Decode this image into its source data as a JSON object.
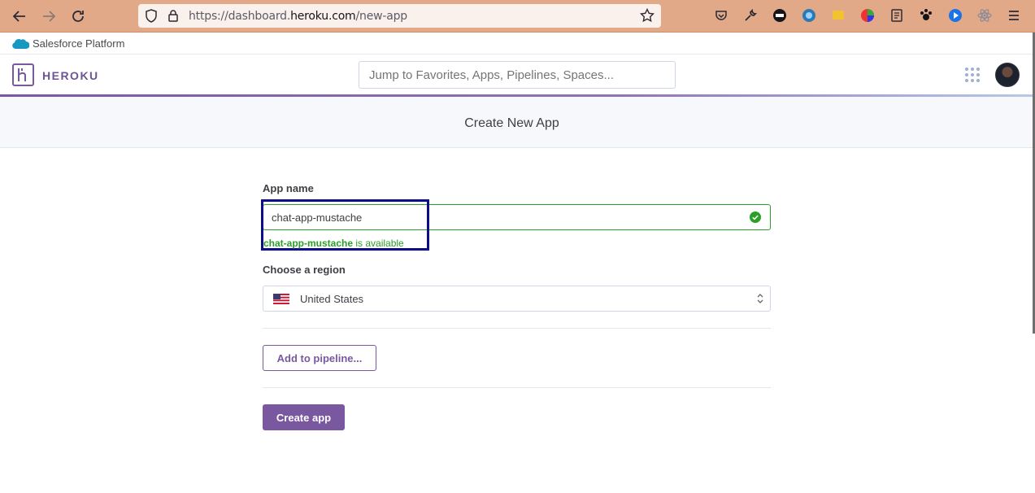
{
  "browser": {
    "url_prefix": "https://dashboard.",
    "url_domain": "heroku.com",
    "url_path": "/new-app",
    "chrome_color": "#e2a988"
  },
  "platform_bar": {
    "label": "Salesforce Platform"
  },
  "header": {
    "logo_text": "HEROKU",
    "search_placeholder": "Jump to Favorites, Apps, Pipelines, Spaces..."
  },
  "page": {
    "title": "Create New App"
  },
  "form": {
    "app_name_label": "App name",
    "app_name_value": "chat-app-mustache",
    "availability_name": "chat-app-mustache",
    "availability_suffix": " is available",
    "region_label": "Choose a region",
    "region_value": "United States",
    "pipeline_button": "Add to pipeline...",
    "create_button": "Create app"
  },
  "colors": {
    "accent": "#79589f",
    "success": "#2aa028",
    "highlight": "#0d0d8a"
  }
}
